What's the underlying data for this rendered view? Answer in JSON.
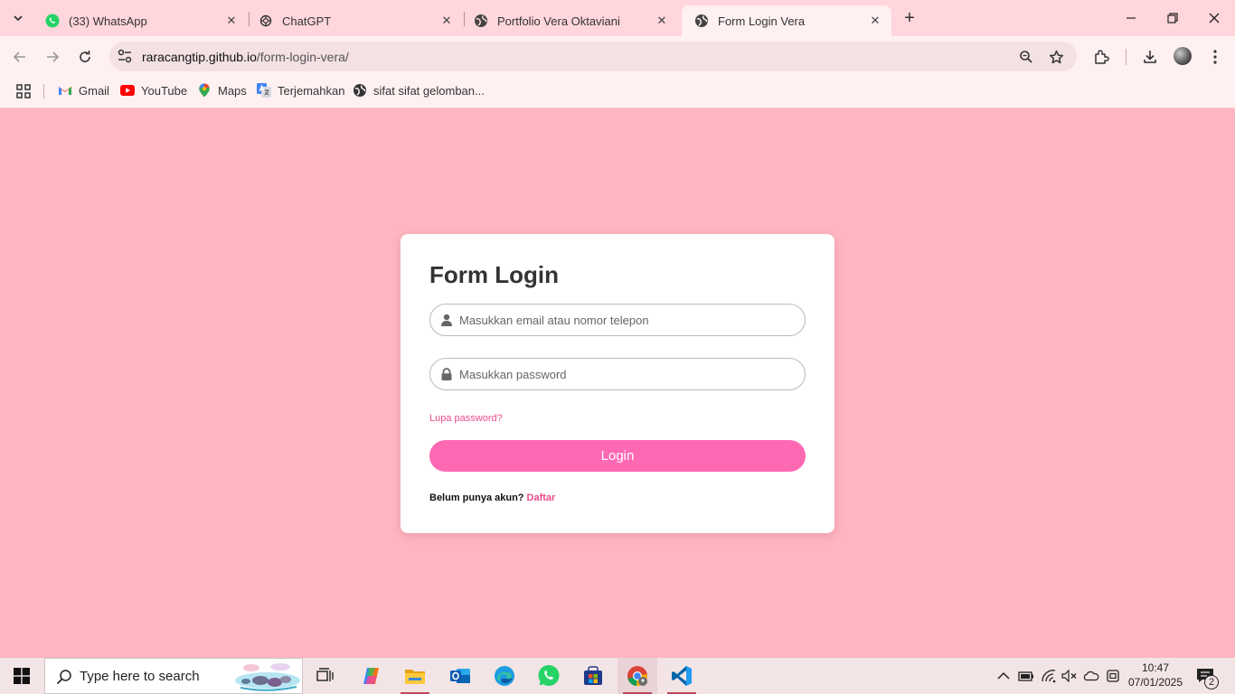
{
  "browser": {
    "tabs": [
      {
        "title": "(33) WhatsApp",
        "icon": "whatsapp-icon"
      },
      {
        "title": "ChatGPT",
        "icon": "chatgpt-icon"
      },
      {
        "title": "Portfolio Vera Oktaviani",
        "icon": "globe-icon"
      },
      {
        "title": "Form Login Vera",
        "icon": "globe-icon",
        "active": true
      }
    ],
    "address": {
      "host": "raracangtip.github.io",
      "path": "/form-login-vera/"
    },
    "bookmarks": [
      {
        "label": "Gmail",
        "icon": "gmail-icon"
      },
      {
        "label": "YouTube",
        "icon": "youtube-icon"
      },
      {
        "label": "Maps",
        "icon": "maps-icon"
      },
      {
        "label": "Terjemahkan",
        "icon": "translate-icon"
      },
      {
        "label": "sifat sifat gelomban...",
        "icon": "globe-icon"
      }
    ]
  },
  "login": {
    "title": "Form Login",
    "email_placeholder": "Masukkan email atau nomor telepon",
    "password_placeholder": "Masukkan password",
    "forgot_label": "Lupa password?",
    "submit_label": "Login",
    "signup_prompt": "Belum punya akun?",
    "signup_link": "Daftar"
  },
  "colors": {
    "page_background": "#ffb6c1",
    "button": "#ff69b4",
    "link": "#e74c8b"
  },
  "taskbar": {
    "search_placeholder": "Type here to search",
    "time": "10:47",
    "date": "07/01/2025",
    "notification_count": "2"
  }
}
